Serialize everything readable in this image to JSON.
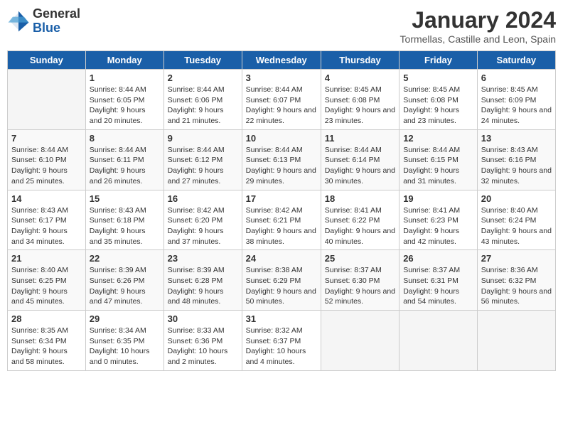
{
  "logo": {
    "general": "General",
    "blue": "Blue"
  },
  "title": "January 2024",
  "location": "Tormellas, Castille and Leon, Spain",
  "days_of_week": [
    "Sunday",
    "Monday",
    "Tuesday",
    "Wednesday",
    "Thursday",
    "Friday",
    "Saturday"
  ],
  "weeks": [
    [
      {
        "day": "",
        "sunrise": "",
        "sunset": "",
        "daylight": ""
      },
      {
        "day": "1",
        "sunrise": "Sunrise: 8:44 AM",
        "sunset": "Sunset: 6:05 PM",
        "daylight": "Daylight: 9 hours and 20 minutes."
      },
      {
        "day": "2",
        "sunrise": "Sunrise: 8:44 AM",
        "sunset": "Sunset: 6:06 PM",
        "daylight": "Daylight: 9 hours and 21 minutes."
      },
      {
        "day": "3",
        "sunrise": "Sunrise: 8:44 AM",
        "sunset": "Sunset: 6:07 PM",
        "daylight": "Daylight: 9 hours and 22 minutes."
      },
      {
        "day": "4",
        "sunrise": "Sunrise: 8:45 AM",
        "sunset": "Sunset: 6:08 PM",
        "daylight": "Daylight: 9 hours and 23 minutes."
      },
      {
        "day": "5",
        "sunrise": "Sunrise: 8:45 AM",
        "sunset": "Sunset: 6:08 PM",
        "daylight": "Daylight: 9 hours and 23 minutes."
      },
      {
        "day": "6",
        "sunrise": "Sunrise: 8:45 AM",
        "sunset": "Sunset: 6:09 PM",
        "daylight": "Daylight: 9 hours and 24 minutes."
      }
    ],
    [
      {
        "day": "7",
        "sunrise": "Sunrise: 8:44 AM",
        "sunset": "Sunset: 6:10 PM",
        "daylight": "Daylight: 9 hours and 25 minutes."
      },
      {
        "day": "8",
        "sunrise": "Sunrise: 8:44 AM",
        "sunset": "Sunset: 6:11 PM",
        "daylight": "Daylight: 9 hours and 26 minutes."
      },
      {
        "day": "9",
        "sunrise": "Sunrise: 8:44 AM",
        "sunset": "Sunset: 6:12 PM",
        "daylight": "Daylight: 9 hours and 27 minutes."
      },
      {
        "day": "10",
        "sunrise": "Sunrise: 8:44 AM",
        "sunset": "Sunset: 6:13 PM",
        "daylight": "Daylight: 9 hours and 29 minutes."
      },
      {
        "day": "11",
        "sunrise": "Sunrise: 8:44 AM",
        "sunset": "Sunset: 6:14 PM",
        "daylight": "Daylight: 9 hours and 30 minutes."
      },
      {
        "day": "12",
        "sunrise": "Sunrise: 8:44 AM",
        "sunset": "Sunset: 6:15 PM",
        "daylight": "Daylight: 9 hours and 31 minutes."
      },
      {
        "day": "13",
        "sunrise": "Sunrise: 8:43 AM",
        "sunset": "Sunset: 6:16 PM",
        "daylight": "Daylight: 9 hours and 32 minutes."
      }
    ],
    [
      {
        "day": "14",
        "sunrise": "Sunrise: 8:43 AM",
        "sunset": "Sunset: 6:17 PM",
        "daylight": "Daylight: 9 hours and 34 minutes."
      },
      {
        "day": "15",
        "sunrise": "Sunrise: 8:43 AM",
        "sunset": "Sunset: 6:18 PM",
        "daylight": "Daylight: 9 hours and 35 minutes."
      },
      {
        "day": "16",
        "sunrise": "Sunrise: 8:42 AM",
        "sunset": "Sunset: 6:20 PM",
        "daylight": "Daylight: 9 hours and 37 minutes."
      },
      {
        "day": "17",
        "sunrise": "Sunrise: 8:42 AM",
        "sunset": "Sunset: 6:21 PM",
        "daylight": "Daylight: 9 hours and 38 minutes."
      },
      {
        "day": "18",
        "sunrise": "Sunrise: 8:41 AM",
        "sunset": "Sunset: 6:22 PM",
        "daylight": "Daylight: 9 hours and 40 minutes."
      },
      {
        "day": "19",
        "sunrise": "Sunrise: 8:41 AM",
        "sunset": "Sunset: 6:23 PM",
        "daylight": "Daylight: 9 hours and 42 minutes."
      },
      {
        "day": "20",
        "sunrise": "Sunrise: 8:40 AM",
        "sunset": "Sunset: 6:24 PM",
        "daylight": "Daylight: 9 hours and 43 minutes."
      }
    ],
    [
      {
        "day": "21",
        "sunrise": "Sunrise: 8:40 AM",
        "sunset": "Sunset: 6:25 PM",
        "daylight": "Daylight: 9 hours and 45 minutes."
      },
      {
        "day": "22",
        "sunrise": "Sunrise: 8:39 AM",
        "sunset": "Sunset: 6:26 PM",
        "daylight": "Daylight: 9 hours and 47 minutes."
      },
      {
        "day": "23",
        "sunrise": "Sunrise: 8:39 AM",
        "sunset": "Sunset: 6:28 PM",
        "daylight": "Daylight: 9 hours and 48 minutes."
      },
      {
        "day": "24",
        "sunrise": "Sunrise: 8:38 AM",
        "sunset": "Sunset: 6:29 PM",
        "daylight": "Daylight: 9 hours and 50 minutes."
      },
      {
        "day": "25",
        "sunrise": "Sunrise: 8:37 AM",
        "sunset": "Sunset: 6:30 PM",
        "daylight": "Daylight: 9 hours and 52 minutes."
      },
      {
        "day": "26",
        "sunrise": "Sunrise: 8:37 AM",
        "sunset": "Sunset: 6:31 PM",
        "daylight": "Daylight: 9 hours and 54 minutes."
      },
      {
        "day": "27",
        "sunrise": "Sunrise: 8:36 AM",
        "sunset": "Sunset: 6:32 PM",
        "daylight": "Daylight: 9 hours and 56 minutes."
      }
    ],
    [
      {
        "day": "28",
        "sunrise": "Sunrise: 8:35 AM",
        "sunset": "Sunset: 6:34 PM",
        "daylight": "Daylight: 9 hours and 58 minutes."
      },
      {
        "day": "29",
        "sunrise": "Sunrise: 8:34 AM",
        "sunset": "Sunset: 6:35 PM",
        "daylight": "Daylight: 10 hours and 0 minutes."
      },
      {
        "day": "30",
        "sunrise": "Sunrise: 8:33 AM",
        "sunset": "Sunset: 6:36 PM",
        "daylight": "Daylight: 10 hours and 2 minutes."
      },
      {
        "day": "31",
        "sunrise": "Sunrise: 8:32 AM",
        "sunset": "Sunset: 6:37 PM",
        "daylight": "Daylight: 10 hours and 4 minutes."
      },
      {
        "day": "",
        "sunrise": "",
        "sunset": "",
        "daylight": ""
      },
      {
        "day": "",
        "sunrise": "",
        "sunset": "",
        "daylight": ""
      },
      {
        "day": "",
        "sunrise": "",
        "sunset": "",
        "daylight": ""
      }
    ]
  ]
}
